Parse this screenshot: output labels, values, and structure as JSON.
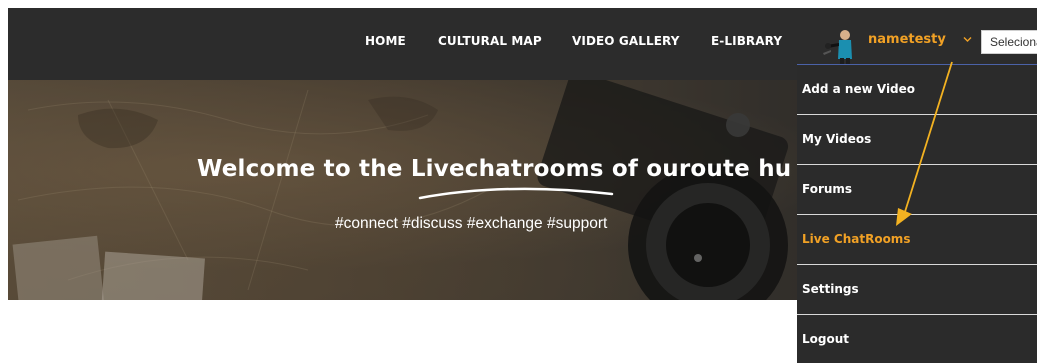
{
  "nav": {
    "items": [
      {
        "label": "HOME"
      },
      {
        "label": "CULTURAL MAP"
      },
      {
        "label": "VIDEO GALLERY"
      },
      {
        "label": "E-LIBRARY"
      }
    ],
    "user": {
      "name": "nametesty",
      "avatar_icon": "user-avatar-icon",
      "chevron_icon": "chevron-down-icon"
    },
    "language_select": {
      "value": "Selecione o idioma",
      "visible_text": "Seleciona"
    }
  },
  "hero": {
    "title": "Welcome to the Livechatrooms of ouroute hu",
    "subtitle": "#connect #discuss #exchange #support"
  },
  "dropdown": {
    "items": [
      {
        "label": "Add a new Video",
        "active": false
      },
      {
        "label": "My Videos",
        "active": false
      },
      {
        "label": "Forums",
        "active": false
      },
      {
        "label": "Live ChatRooms",
        "active": true
      },
      {
        "label": "Settings",
        "active": false
      },
      {
        "label": "Logout",
        "active": false
      }
    ]
  },
  "colors": {
    "nav_bg": "#2c2c2c",
    "accent": "#f1a125",
    "dropdown_bg": "#2b2b2b",
    "annotation_arrow": "#f3b221"
  }
}
